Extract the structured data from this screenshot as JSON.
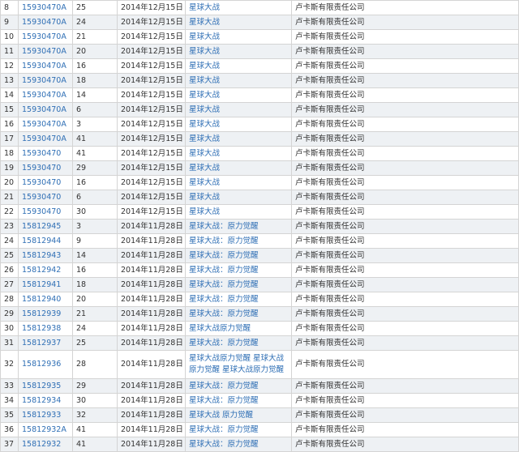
{
  "rows": [
    {
      "idx": "8",
      "reg": "15930470A",
      "cls": "25",
      "date": "2014年12月15日",
      "mark": "星球大战",
      "owner": "卢卡斯有限责任公司"
    },
    {
      "idx": "9",
      "reg": "15930470A",
      "cls": "24",
      "date": "2014年12月15日",
      "mark": "星球大战",
      "owner": "卢卡斯有限责任公司"
    },
    {
      "idx": "10",
      "reg": "15930470A",
      "cls": "21",
      "date": "2014年12月15日",
      "mark": "星球大战",
      "owner": "卢卡斯有限责任公司"
    },
    {
      "idx": "11",
      "reg": "15930470A",
      "cls": "20",
      "date": "2014年12月15日",
      "mark": "星球大战",
      "owner": "卢卡斯有限责任公司"
    },
    {
      "idx": "12",
      "reg": "15930470A",
      "cls": "16",
      "date": "2014年12月15日",
      "mark": "星球大战",
      "owner": "卢卡斯有限责任公司"
    },
    {
      "idx": "13",
      "reg": "15930470A",
      "cls": "18",
      "date": "2014年12月15日",
      "mark": "星球大战",
      "owner": "卢卡斯有限责任公司"
    },
    {
      "idx": "14",
      "reg": "15930470A",
      "cls": "14",
      "date": "2014年12月15日",
      "mark": "星球大战",
      "owner": "卢卡斯有限责任公司"
    },
    {
      "idx": "15",
      "reg": "15930470A",
      "cls": "6",
      "date": "2014年12月15日",
      "mark": "星球大战",
      "owner": "卢卡斯有限责任公司"
    },
    {
      "idx": "16",
      "reg": "15930470A",
      "cls": "3",
      "date": "2014年12月15日",
      "mark": "星球大战",
      "owner": "卢卡斯有限责任公司"
    },
    {
      "idx": "17",
      "reg": "15930470A",
      "cls": "41",
      "date": "2014年12月15日",
      "mark": "星球大战",
      "owner": "卢卡斯有限责任公司"
    },
    {
      "idx": "18",
      "reg": "15930470",
      "cls": "41",
      "date": "2014年12月15日",
      "mark": "星球大战",
      "owner": "卢卡斯有限责任公司"
    },
    {
      "idx": "19",
      "reg": "15930470",
      "cls": "29",
      "date": "2014年12月15日",
      "mark": "星球大战",
      "owner": "卢卡斯有限责任公司"
    },
    {
      "idx": "20",
      "reg": "15930470",
      "cls": "16",
      "date": "2014年12月15日",
      "mark": "星球大战",
      "owner": "卢卡斯有限责任公司"
    },
    {
      "idx": "21",
      "reg": "15930470",
      "cls": "6",
      "date": "2014年12月15日",
      "mark": "星球大战",
      "owner": "卢卡斯有限责任公司"
    },
    {
      "idx": "22",
      "reg": "15930470",
      "cls": "30",
      "date": "2014年12月15日",
      "mark": "星球大战",
      "owner": "卢卡斯有限责任公司"
    },
    {
      "idx": "23",
      "reg": "15812945",
      "cls": "3",
      "date": "2014年11月28日",
      "mark": "星球大战：原力觉醒",
      "owner": "卢卡斯有限责任公司"
    },
    {
      "idx": "24",
      "reg": "15812944",
      "cls": "9",
      "date": "2014年11月28日",
      "mark": "星球大战：原力觉醒",
      "owner": "卢卡斯有限责任公司"
    },
    {
      "idx": "25",
      "reg": "15812943",
      "cls": "14",
      "date": "2014年11月28日",
      "mark": "星球大战：原力觉醒",
      "owner": "卢卡斯有限责任公司"
    },
    {
      "idx": "26",
      "reg": "15812942",
      "cls": "16",
      "date": "2014年11月28日",
      "mark": "星球大战：原力觉醒",
      "owner": "卢卡斯有限责任公司"
    },
    {
      "idx": "27",
      "reg": "15812941",
      "cls": "18",
      "date": "2014年11月28日",
      "mark": "星球大战：原力觉醒",
      "owner": "卢卡斯有限责任公司"
    },
    {
      "idx": "28",
      "reg": "15812940",
      "cls": "20",
      "date": "2014年11月28日",
      "mark": "星球大战：原力觉醒",
      "owner": "卢卡斯有限责任公司"
    },
    {
      "idx": "29",
      "reg": "15812939",
      "cls": "21",
      "date": "2014年11月28日",
      "mark": "星球大战：原力觉醒",
      "owner": "卢卡斯有限责任公司"
    },
    {
      "idx": "30",
      "reg": "15812938",
      "cls": "24",
      "date": "2014年11月28日",
      "mark": "星球大战原力觉醒",
      "owner": "卢卡斯有限责任公司"
    },
    {
      "idx": "31",
      "reg": "15812937",
      "cls": "25",
      "date": "2014年11月28日",
      "mark": "星球大战：原力觉醒",
      "owner": "卢卡斯有限责任公司"
    },
    {
      "idx": "32",
      "reg": "15812936",
      "cls": "28",
      "date": "2014年11月28日",
      "mark": "星球大战原力觉醒 星球大战原力觉醒 星球大战原力觉醒",
      "owner": "卢卡斯有限责任公司"
    },
    {
      "idx": "33",
      "reg": "15812935",
      "cls": "29",
      "date": "2014年11月28日",
      "mark": "星球大战：原力觉醒",
      "owner": "卢卡斯有限责任公司"
    },
    {
      "idx": "34",
      "reg": "15812934",
      "cls": "30",
      "date": "2014年11月28日",
      "mark": "星球大战：原力觉醒",
      "owner": "卢卡斯有限责任公司"
    },
    {
      "idx": "35",
      "reg": "15812933",
      "cls": "32",
      "date": "2014年11月28日",
      "mark": "星球大战 原力觉醒",
      "owner": "卢卡斯有限责任公司"
    },
    {
      "idx": "36",
      "reg": "15812932A",
      "cls": "41",
      "date": "2014年11月28日",
      "mark": "星球大战：原力觉醒",
      "owner": "卢卡斯有限责任公司"
    },
    {
      "idx": "37",
      "reg": "15812932",
      "cls": "41",
      "date": "2014年11月28日",
      "mark": "星球大战：原力觉醒",
      "owner": "卢卡斯有限责任公司"
    }
  ],
  "colors": {
    "link": "#2f6fb5",
    "text": "#333333",
    "row_alt_bg": "#eef1f4",
    "border": "#d4d4d4"
  }
}
